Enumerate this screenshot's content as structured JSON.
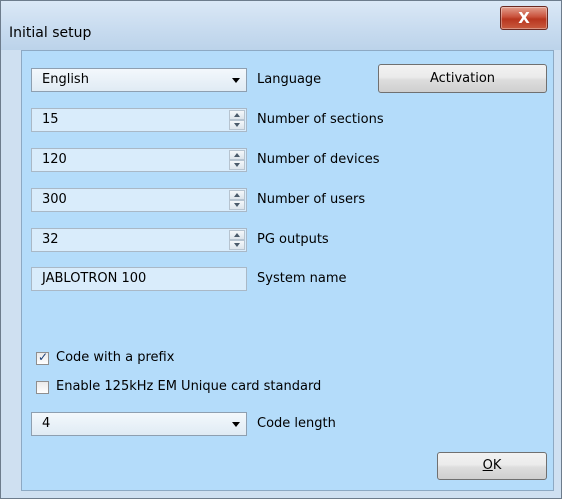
{
  "window": {
    "title": "Initial setup",
    "close_glyph": "X"
  },
  "language": {
    "value": "English",
    "label": "Language"
  },
  "activation_button": "Activation",
  "sections": {
    "value": "15",
    "label": "Number of sections"
  },
  "devices": {
    "value": "120",
    "label": "Number of devices"
  },
  "users": {
    "value": "300",
    "label": "Number of users"
  },
  "pg_outputs": {
    "value": "32",
    "label": "PG outputs"
  },
  "system_name": {
    "value": "JABLOTRON 100",
    "label": "System name"
  },
  "code_prefix": {
    "label": "Code with a prefix",
    "checked": true
  },
  "em_card": {
    "label": "Enable 125kHz EM Unique card standard",
    "checked": false
  },
  "code_length": {
    "value": "4",
    "label": "Code length"
  },
  "ok_button": {
    "mnemonic": "O",
    "rest": "K"
  }
}
